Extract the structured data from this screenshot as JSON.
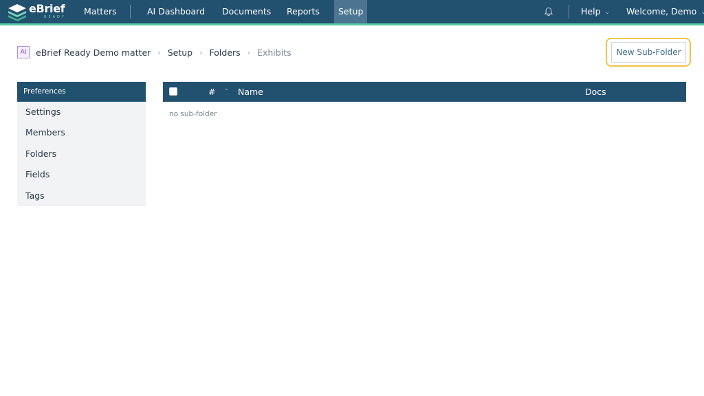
{
  "brand": {
    "name": "eBrief",
    "sub": "READY"
  },
  "nav": {
    "items": [
      {
        "label": "Matters"
      },
      {
        "label": "AI Dashboard"
      },
      {
        "label": "Documents"
      },
      {
        "label": "Reports"
      },
      {
        "label": "Setup",
        "active": true
      }
    ],
    "help": "Help",
    "welcome": "Welcome, Demo"
  },
  "breadcrumb": {
    "badge": "AI",
    "items": [
      "eBrief Ready Demo matter",
      "Setup",
      "Folders",
      "Exhibits"
    ]
  },
  "actions": {
    "new_subfolder": "New Sub-Folder"
  },
  "sidebar": {
    "header": "Preferences",
    "items": [
      {
        "label": "Settings"
      },
      {
        "label": "Members"
      },
      {
        "label": "Folders"
      },
      {
        "label": "Fields"
      },
      {
        "label": "Tags"
      }
    ]
  },
  "table": {
    "columns": {
      "number": "#",
      "name": "Name",
      "docs": "Docs"
    },
    "empty_text": "no sub-folder"
  },
  "colors": {
    "primary": "#22506f",
    "accent": "#54c8a6",
    "highlight": "#f0c24a"
  },
  "icons": [
    "ebrief-logo-icon",
    "bell-icon",
    "chevron-down-icon",
    "chevron-right-icon",
    "sort-up-icon"
  ]
}
